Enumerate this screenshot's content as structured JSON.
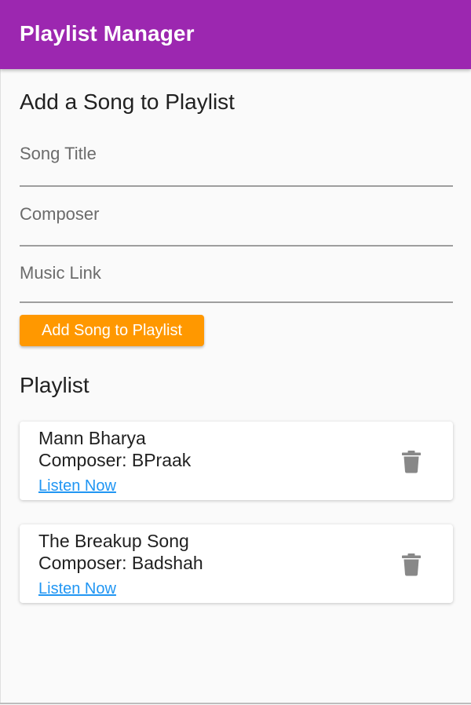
{
  "app": {
    "title": "Playlist Manager",
    "accent_color": "#9c27b0",
    "button_color": "#ff9800",
    "link_color": "#2196f3"
  },
  "form": {
    "heading": "Add a Song to Playlist",
    "fields": [
      {
        "placeholder": "Song Title",
        "value": ""
      },
      {
        "placeholder": "Composer",
        "value": ""
      },
      {
        "placeholder": "Music Link",
        "value": ""
      }
    ],
    "submit_label": "Add Song to Playlist"
  },
  "playlist": {
    "heading": "Playlist",
    "items": [
      {
        "title": "Mann Bharya",
        "composer_label": "Composer:",
        "composer": "BPraak",
        "link_label": "Listen Now",
        "delete_icon": "trash-icon"
      },
      {
        "title": "The Breakup Song",
        "composer_label": "Composer:",
        "composer": "Badshah",
        "link_label": "Listen Now",
        "delete_icon": "trash-icon"
      }
    ]
  }
}
